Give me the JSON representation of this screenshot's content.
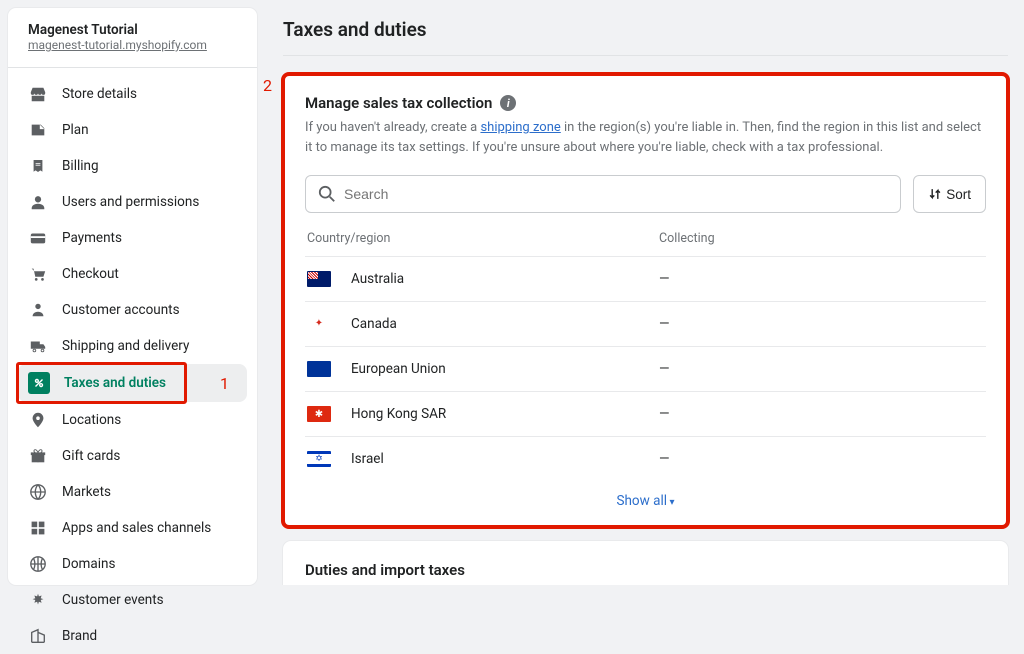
{
  "store": {
    "name": "Magenest Tutorial",
    "url": "magenest-tutorial.myshopify.com"
  },
  "nav": {
    "store_details": "Store details",
    "plan": "Plan",
    "billing": "Billing",
    "users": "Users and permissions",
    "payments": "Payments",
    "checkout": "Checkout",
    "customer_accounts": "Customer accounts",
    "shipping": "Shipping and delivery",
    "taxes": "Taxes and duties",
    "locations": "Locations",
    "gift_cards": "Gift cards",
    "markets": "Markets",
    "apps": "Apps and sales channels",
    "domains": "Domains",
    "customer_events": "Customer events",
    "brand": "Brand"
  },
  "page": {
    "title": "Taxes and duties"
  },
  "manage": {
    "title": "Manage sales tax collection",
    "desc_a": "If you haven't already, create a ",
    "desc_link": "shipping zone",
    "desc_b": " in the region(s) you're liable in. Then, find the region in this list and select it to manage its tax settings. If you're unsure about where you're liable, check with a tax professional.",
    "search_placeholder": "Search",
    "sort": "Sort",
    "col_region": "Country/region",
    "col_collecting": "Collecting",
    "rows": {
      "au": {
        "name": "Australia",
        "collecting": "—"
      },
      "ca": {
        "name": "Canada",
        "collecting": "—"
      },
      "eu": {
        "name": "European Union",
        "collecting": "—"
      },
      "hk": {
        "name": "Hong Kong SAR",
        "collecting": "—"
      },
      "il": {
        "name": "Israel",
        "collecting": "—"
      }
    },
    "show_all": "Show all"
  },
  "duties": {
    "title": "Duties and import taxes"
  },
  "annot": {
    "one": "1",
    "two": "2"
  }
}
